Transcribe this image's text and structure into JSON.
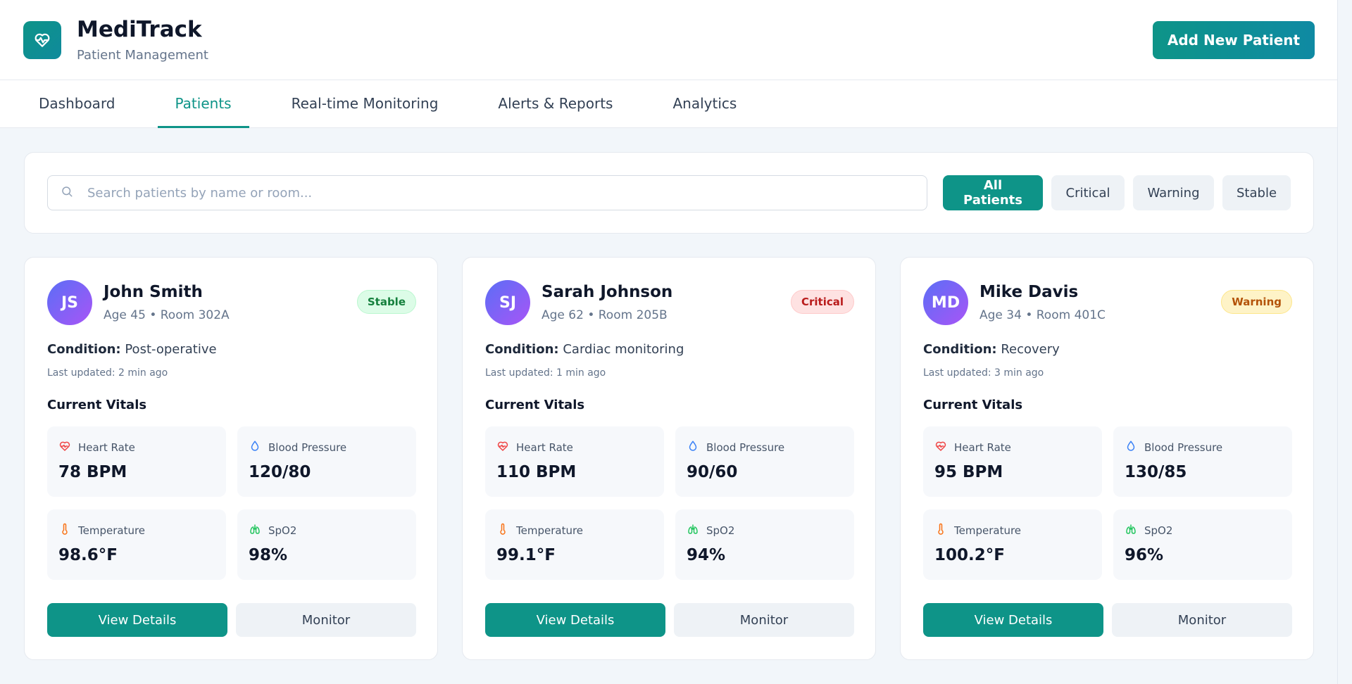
{
  "app": {
    "name": "MediTrack",
    "subtitle": "Patient Management"
  },
  "header": {
    "add_button": "Add New Patient"
  },
  "tabs": [
    {
      "label": "Dashboard",
      "active": false
    },
    {
      "label": "Patients",
      "active": true
    },
    {
      "label": "Real-time Monitoring",
      "active": false
    },
    {
      "label": "Alerts & Reports",
      "active": false
    },
    {
      "label": "Analytics",
      "active": false
    }
  ],
  "search": {
    "placeholder": "Search patients by name or room..."
  },
  "filters": [
    {
      "label": "All Patients",
      "active": true
    },
    {
      "label": "Critical",
      "active": false
    },
    {
      "label": "Warning",
      "active": false
    },
    {
      "label": "Stable",
      "active": false
    }
  ],
  "labels": {
    "condition": "Condition:",
    "current_vitals": "Current Vitals",
    "heart_rate": "Heart Rate",
    "blood_pressure": "Blood Pressure",
    "temperature": "Temperature",
    "spo2": "SpO2",
    "view_details": "View Details",
    "monitor": "Monitor"
  },
  "patients": [
    {
      "initials": "JS",
      "name": "John Smith",
      "meta": "Age 45 • Room 302A",
      "status": "Stable",
      "condition": "Post-operative",
      "updated": "Last updated: 2 min ago",
      "heart_rate": "78 BPM",
      "blood_pressure": "120/80",
      "temperature": "98.6°F",
      "spo2": "98%"
    },
    {
      "initials": "SJ",
      "name": "Sarah Johnson",
      "meta": "Age 62 • Room 205B",
      "status": "Critical",
      "condition": "Cardiac monitoring",
      "updated": "Last updated: 1 min ago",
      "heart_rate": "110 BPM",
      "blood_pressure": "90/60",
      "temperature": "99.1°F",
      "spo2": "94%"
    },
    {
      "initials": "MD",
      "name": "Mike Davis",
      "meta": "Age 34 • Room 401C",
      "status": "Warning",
      "condition": "Recovery",
      "updated": "Last updated: 3 min ago",
      "heart_rate": "95 BPM",
      "blood_pressure": "130/85",
      "temperature": "100.2°F",
      "spo2": "96%"
    }
  ],
  "colors": {
    "accent": "#0e9488",
    "stable_bg": "#dcfce7",
    "stable_fg": "#15803d",
    "critical_bg": "#fee2e2",
    "critical_fg": "#b91c1c",
    "warning_bg": "#fef3c7",
    "warning_fg": "#b45309"
  }
}
